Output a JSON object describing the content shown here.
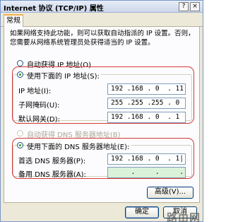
{
  "window": {
    "title": "Internet 协议 (TCP/IP) 属性",
    "help_glyph": "?",
    "close_glyph": "×"
  },
  "tabs": [
    {
      "label": "常规"
    }
  ],
  "description": "如果网络支持此功能，则可以获取自动指派的 IP 设置。否则，您需要从网络系统管理员处获得适当的 IP 设置。",
  "ip_mode": {
    "auto_label": "自动获得 IP 地址(O)",
    "auto_selected": false,
    "manual_label": "使用下面的 IP 地址(S):",
    "manual_selected": true
  },
  "ip_fields": [
    {
      "label": "IP 地址(I):",
      "value": "192 .168 . 0  . 11"
    },
    {
      "label": "子网掩码(U):",
      "value": "255 .255 .255 . 0"
    },
    {
      "label": "默认网关(D):",
      "value": "192 .168 . 0  . 1"
    }
  ],
  "dns_mode": {
    "auto_label": "自动获得 DNS 服务器地址(B)",
    "auto_selected": false,
    "auto_disabled": true,
    "manual_label": "使用下面的 DNS 服务器地址(E):",
    "manual_selected": true
  },
  "dns_fields": [
    {
      "label": "首选 DNS 服务器(P):",
      "value": "192 .168 . 0  . 1|"
    },
    {
      "label": "备用 DNS 服务器(A):",
      "value": "     .     .     ."
    }
  ],
  "buttons": {
    "advanced": "高级(V)...",
    "ok": "确定",
    "cancel": "取消"
  },
  "watermark": "路由网",
  "colors": {
    "highlight_box": "#d63838",
    "dialog_bg": "#ece9d8",
    "field_green": "#d9f2d9"
  }
}
